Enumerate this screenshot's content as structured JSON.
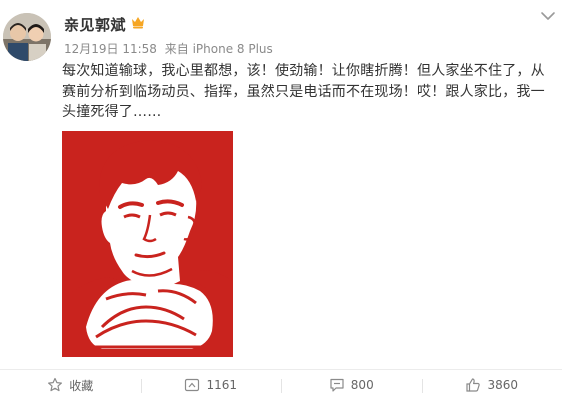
{
  "post": {
    "author": "亲见郭斌",
    "date": "12月19日 11:58",
    "source": "来自 iPhone 8 Plus",
    "text": "每次知道输球，我心里都想，该！使劲输！让你瞎折腾！但人家坐不住了，从赛前分析到临场动员、指挥，虽然只是电话而不在现场！哎！跟人家比，我一头撞死得了……",
    "image": "red papercut-style portrait of a man resting chin on clasped hands"
  },
  "actions": {
    "favorite": "收藏",
    "repost": "1161",
    "comment": "800",
    "like": "3860"
  },
  "icons": {
    "vip": "vip-badge-icon",
    "more": "chevron-down-icon",
    "favorite": "star-icon",
    "repost": "repost-icon",
    "comment": "comment-icon",
    "like": "thumbs-up-icon"
  },
  "colors": {
    "text": "#333333",
    "meta": "#8a8a8a",
    "vip": "#f6a623",
    "papercut": "#c9231e"
  }
}
